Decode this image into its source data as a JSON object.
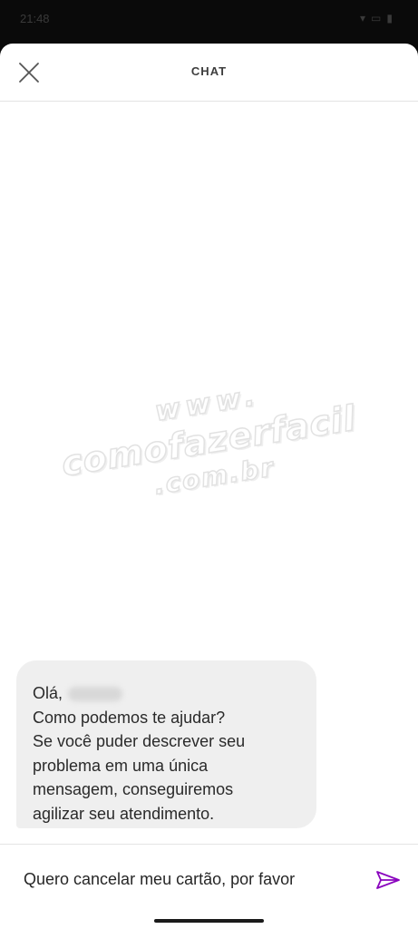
{
  "status_bar": {
    "time": "21:48",
    "icons": [
      "notification-icon",
      "wifi-icon",
      "battery-icon"
    ]
  },
  "header": {
    "title": "CHAT",
    "close_icon": "close-icon"
  },
  "watermark": {
    "line1": "www.",
    "line2": "comofazerfacil",
    "line3": ".com.br"
  },
  "messages": [
    {
      "sender": "agent",
      "greeting": "Olá,",
      "lines": [
        "Como podemos te ajudar?",
        "Se você puder descrever seu",
        "problema em uma única",
        "mensagem, conseguiremos",
        "agilizar seu atendimento."
      ]
    }
  ],
  "composer": {
    "value": "Quero cancelar meu cartão, por favor",
    "send_icon": "send-icon"
  },
  "colors": {
    "accent": "#8a05be",
    "bubble": "#efefef",
    "text": "#2a2a2a",
    "divider": "#e4e4e4"
  }
}
